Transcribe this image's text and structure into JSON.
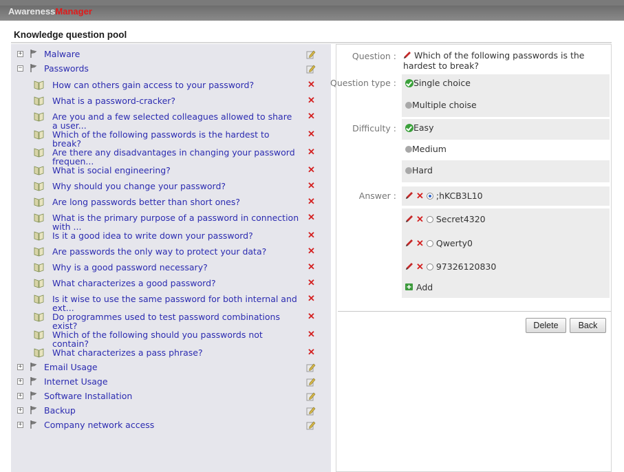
{
  "app": {
    "brand_part1": "Awareness",
    "brand_part2": "Manager"
  },
  "page": {
    "title": "Knowledge question pool"
  },
  "tree": {
    "categories_top": [
      {
        "label": "Malware",
        "expander": "+"
      },
      {
        "label": "Passwords",
        "expander": "−"
      }
    ],
    "questions": [
      {
        "line1": "How can others gain access to your password?",
        "line2": ""
      },
      {
        "line1": "What is a password-cracker?",
        "line2": ""
      },
      {
        "line1": "Are you and a few selected colleagues allowed to share",
        "line2": "a user..."
      },
      {
        "line1": "Which of the following passwords is the hardest to",
        "line2": "break?"
      },
      {
        "line1": "Are there any disadvantages in changing your password",
        "line2": "frequen..."
      },
      {
        "line1": "What is social engineering?",
        "line2": ""
      },
      {
        "line1": "Why should you change your password?",
        "line2": ""
      },
      {
        "line1": "Are long passwords better than short ones?",
        "line2": ""
      },
      {
        "line1": "What is the primary purpose of a password in connection",
        "line2": "with ..."
      },
      {
        "line1": "Is it a good idea to write down your password?",
        "line2": ""
      },
      {
        "line1": "Are passwords the only way to protect your data?",
        "line2": ""
      },
      {
        "line1": "Why is a good password necessary?",
        "line2": ""
      },
      {
        "line1": "What characterizes a good password?",
        "line2": ""
      },
      {
        "line1": "Is it wise to use the same password for both internal and",
        "line2": "ext..."
      },
      {
        "line1": "Do programmes used to test password combinations",
        "line2": "exist?"
      },
      {
        "line1": "Which of the following should you passwords not",
        "line2": "contain?"
      },
      {
        "line1": "What characterizes a pass phrase?",
        "line2": ""
      }
    ],
    "categories_bottom": [
      {
        "label": "Email Usage",
        "expander": "+"
      },
      {
        "label": "Internet Usage",
        "expander": "+"
      },
      {
        "label": "Software Installation",
        "expander": "+"
      },
      {
        "label": "Backup",
        "expander": "+"
      },
      {
        "label": "Company network access",
        "expander": "+"
      }
    ],
    "delete_glyph": "✕"
  },
  "detail": {
    "question_label": "Question :",
    "question_line1": "Which of the following passwords is the",
    "question_line2": "hardest to break?",
    "type_label": "Question type :",
    "type_options": [
      "Single choice",
      "Multiple choise"
    ],
    "type_selected": 0,
    "difficulty_label": "Difficulty :",
    "difficulty_options": [
      "Easy",
      "Medium",
      "Hard"
    ],
    "difficulty_selected": 0,
    "answer_label": "Answer :",
    "answers": [
      ";hKCB3L10",
      "Secret4320",
      "Qwerty0",
      "97326120830"
    ],
    "answer_selected": 0,
    "add_label": "Add",
    "delete_button": "Delete",
    "back_button": "Back",
    "colors": {
      "link": "#2b2bb0",
      "delete": "#d42020",
      "brand_accent": "#e01a1a",
      "tree_bg": "#e6e6ec"
    }
  }
}
